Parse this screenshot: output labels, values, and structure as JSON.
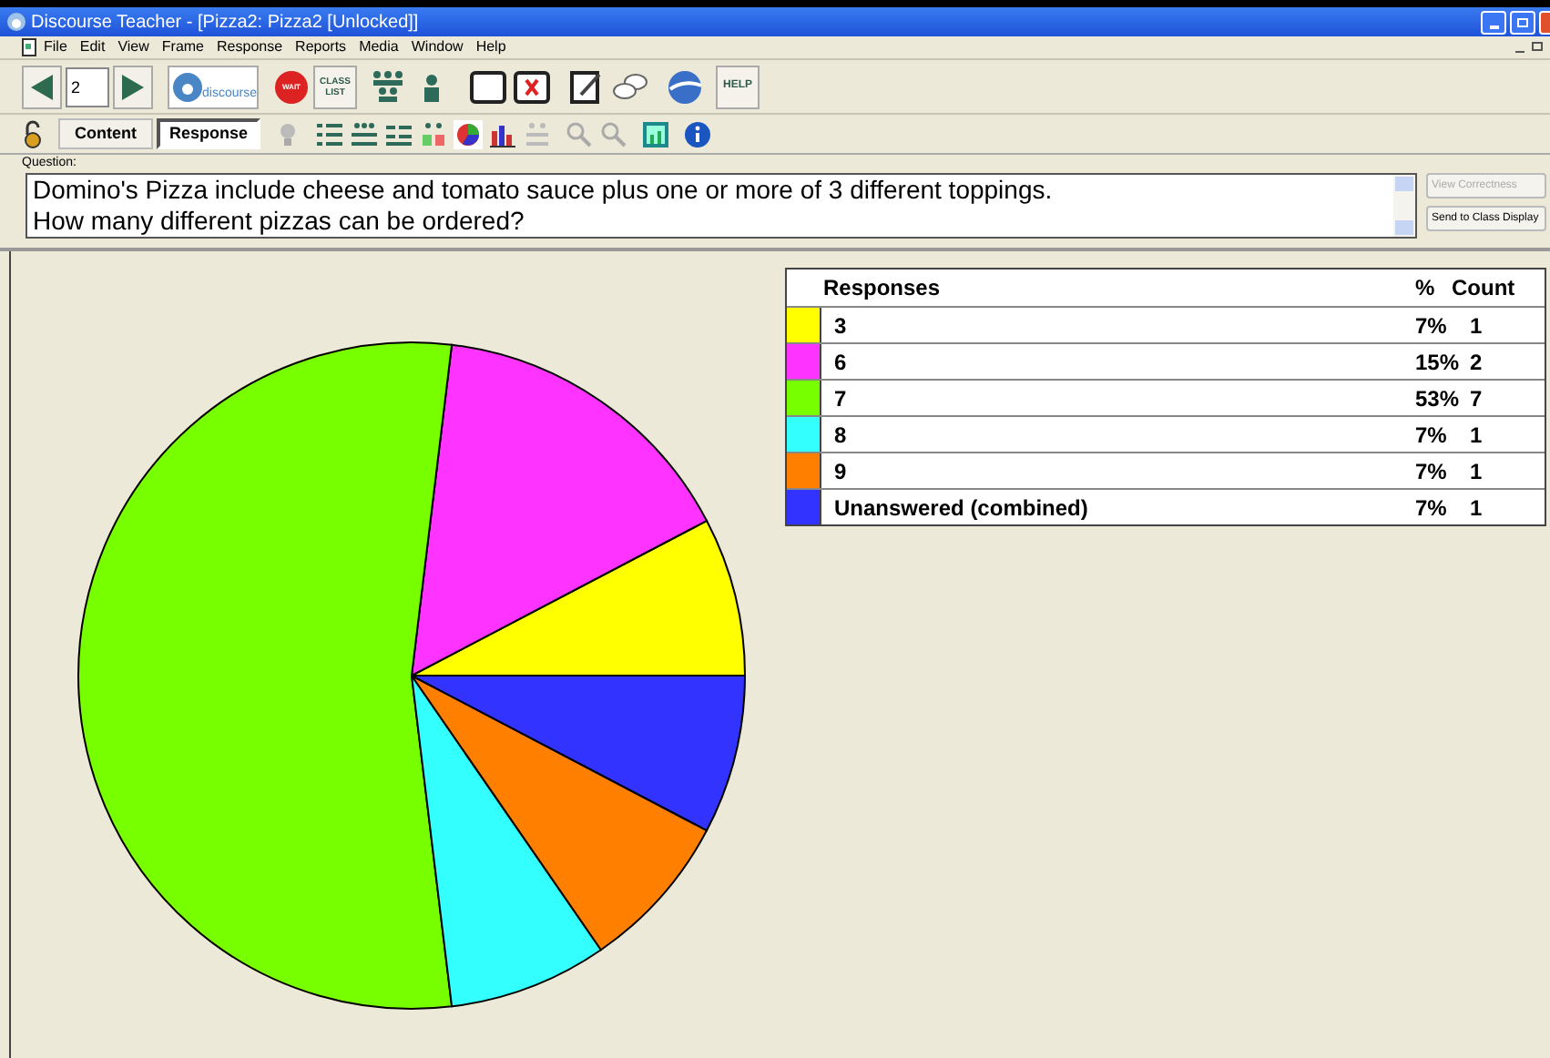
{
  "window": {
    "title": "Discourse Teacher - [Pizza2: Pizza2 [Unlocked]]"
  },
  "menu": [
    "File",
    "Edit",
    "View",
    "Frame",
    "Response",
    "Reports",
    "Media",
    "Window",
    "Help"
  ],
  "toolbar": {
    "frame_number": "2",
    "class_list_label": "CLASS LIST",
    "logo_text": "discourse",
    "wait_label": "WAIT",
    "help_label": "HELP"
  },
  "view_tabs": [
    {
      "label": "Content",
      "selected": false
    },
    {
      "label": "Response",
      "selected": true
    }
  ],
  "question": {
    "label": "Question:",
    "text": "Domino's Pizza include cheese and tomato sauce plus one or more of 3 different toppings.\nHow many different pizzas can be ordered?"
  },
  "side_buttons": [
    {
      "label": "View Correctness",
      "disabled": true
    },
    {
      "label": "Send to Class Display",
      "disabled": false
    }
  ],
  "table": {
    "columns": [
      "Responses",
      "%",
      "Count"
    ],
    "rows": [
      {
        "percent": "7%",
        "count": "1",
        "color": "#ffff00"
      },
      {
        "percent": "15%",
        "count": "2",
        "color": "#ff33ff"
      },
      {
        "percent": "53%",
        "count": "7",
        "color": "#77ff00"
      },
      {
        "percent": "7%",
        "count": "1",
        "color": "#33ffff"
      },
      {
        "percent": "7%",
        "count": "1",
        "color": "#ff8000"
      },
      {
        "percent": "7%",
        "count": "1",
        "color": "#3333ff"
      }
    ]
  },
  "chart_data": {
    "type": "pie",
    "categories": [
      "3",
      "6",
      "7",
      "8",
      "9",
      "Unanswered (combined)"
    ],
    "values": [
      1,
      2,
      7,
      1,
      1,
      1
    ]
  }
}
